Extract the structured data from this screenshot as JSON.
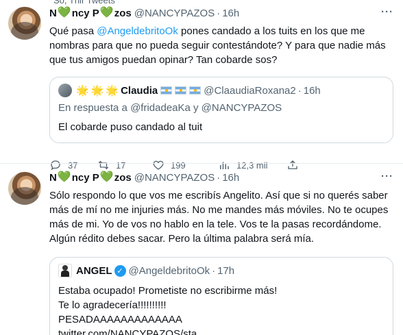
{
  "top_partial": "So, Thir Tweets",
  "tweets": [
    {
      "author_name_parts": [
        "N",
        "ncy P",
        "zos"
      ],
      "handle": "@NANCYPAZOS",
      "time": "16h",
      "text_before": "Qué pasa ",
      "text_mention": "@AngeldebritoOk",
      "text_after": " pones candado a los tuits en los que me nombras para que no pueda seguir contestándote? Y para que nadie más que tus amigos puedan opinar? Tan cobarde sos?",
      "quote": {
        "name": "Claudia",
        "handle": "@ClaaudiaRoxana2",
        "time": "16h",
        "reply_to": "En respuesta a @fridadeaKa y @NANCYPAZOS",
        "text": "El cobarde puso candado al tuit"
      },
      "metrics": {
        "replies": "37",
        "retweets": "17",
        "likes": "199",
        "views": "12,3 mil"
      }
    },
    {
      "author_name_parts": [
        "N",
        "ncy P",
        "zos"
      ],
      "handle": "@NANCYPAZOS",
      "time": "16h",
      "text": "Sólo respondo lo que vos me escribís Angelito. Así que si no querés  saber más de mí no me injuries más. No me mandes más móviles. No te ocupes más de mi. Yo de vos no hablo en la tele. Vos te la pasas recordándome. Algún rédito debes sacar. Pero la última palabra será mía.",
      "quote": {
        "name": "ANGEL",
        "handle": "@AngeldebritoOk",
        "time": "17h",
        "text": "Estaba ocupado! Prometiste no escribirme más! Te lo agradecería!!!!!!!!!! PESADAAAAAAAAAAAAA twitter.com/NANCYPAZOS/sta..."
      }
    }
  ],
  "symbols": {
    "heart": "💚",
    "dot": "·",
    "more": "···",
    "star": "🌟",
    "check": "✓"
  }
}
